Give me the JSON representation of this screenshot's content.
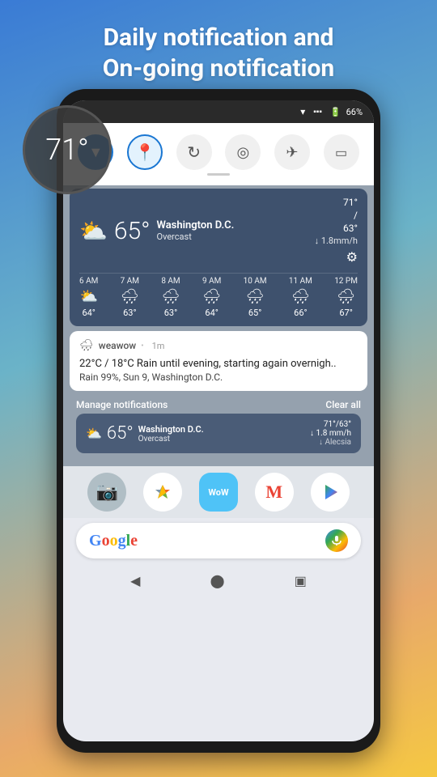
{
  "header": {
    "line1": "Daily notification and",
    "line2": "On-going notification"
  },
  "temp_bubble": {
    "temperature": "71°"
  },
  "status_bar": {
    "battery": "66%",
    "battery_icon": "🔋"
  },
  "quick_settings": {
    "icons": [
      {
        "name": "location-down",
        "type": "active-blue",
        "symbol": "▼"
      },
      {
        "name": "location-pin",
        "type": "active-blue-outline",
        "symbol": "📍"
      },
      {
        "name": "sync",
        "type": "inactive",
        "symbol": "↻"
      },
      {
        "name": "hotspot",
        "type": "inactive",
        "symbol": "◎"
      },
      {
        "name": "airplane",
        "type": "inactive",
        "symbol": "✈"
      },
      {
        "name": "cast",
        "type": "inactive",
        "symbol": "▭"
      }
    ]
  },
  "weather_widget": {
    "temp": "65°",
    "location": "Washington D.C.",
    "condition": "Overcast",
    "high": "71°",
    "low": "63°",
    "rain_rate": "↓ 1.8mm/h",
    "hourly": [
      {
        "time": "6 AM",
        "icon": "⛅",
        "temp": "64°"
      },
      {
        "time": "7 AM",
        "icon": "🌧",
        "temp": "63°"
      },
      {
        "time": "8 AM",
        "icon": "🌧",
        "temp": "63°"
      },
      {
        "time": "9 AM",
        "icon": "🌧",
        "temp": "64°"
      },
      {
        "time": "10 AM",
        "icon": "🌧",
        "temp": "65°"
      },
      {
        "time": "11 AM",
        "icon": "🌧",
        "temp": "66°"
      },
      {
        "time": "12 PM",
        "icon": "🌧",
        "temp": "67°"
      }
    ]
  },
  "notification": {
    "app_name": "weawow",
    "time_ago": "1m",
    "body_line1": "22°C / 18°C Rain until evening, starting again overnigh..",
    "body_line2": "Rain 99%, Sun 9, Washington D.C."
  },
  "manage_bar": {
    "label": "Manage notifications",
    "clear_all": "Clear all"
  },
  "mini_weather": {
    "temp": "65°",
    "location": "Washington D.C.",
    "condition": "Overcast",
    "high_low": "71°/63°",
    "rain": "↓ 1.8 mm/h",
    "sub": "↓ Alecsia"
  },
  "dock": {
    "apps": [
      {
        "name": "camera",
        "symbol": "📷",
        "bg": "#b0bec5"
      },
      {
        "name": "photos",
        "symbol": "✦",
        "bg": "white"
      },
      {
        "name": "wow",
        "symbol": "WoW",
        "bg": "#4fc3f7"
      },
      {
        "name": "gmail",
        "symbol": "M",
        "bg": "white"
      },
      {
        "name": "play",
        "symbol": "▶",
        "bg": "white"
      }
    ]
  },
  "search_bar": {
    "g_label": "G",
    "mic_symbol": "◉"
  }
}
